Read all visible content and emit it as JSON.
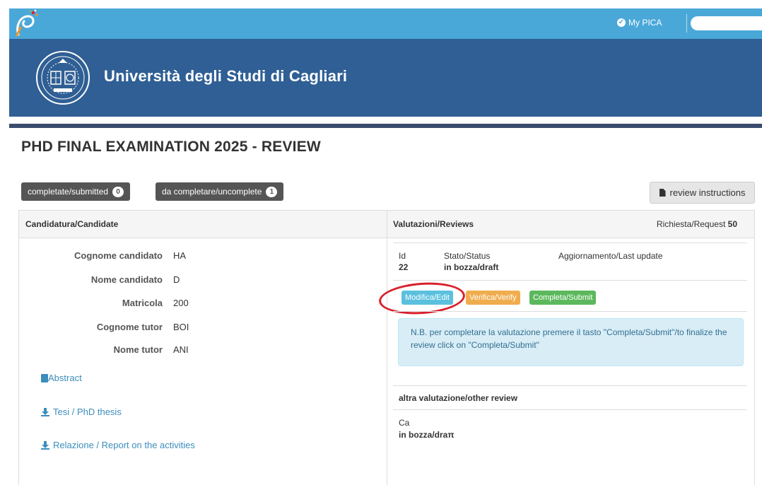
{
  "topbar": {
    "my_pica": "My PICA",
    "colors": {
      "bar": "#4aa8d8",
      "banner": "#2f5f94"
    }
  },
  "banner": {
    "university": "Università degli Studi di Cagliari"
  },
  "page": {
    "title": "PHD FINAL EXAMINATION 2025 - REVIEW"
  },
  "filters": {
    "submitted": {
      "label": "completate/submitted",
      "count": "0"
    },
    "uncomplete": {
      "label": "da completare/uncomplete",
      "count": "1"
    },
    "instructions": "review instructions"
  },
  "candidate": {
    "heading": "Candidatura/Candidate",
    "fields": [
      {
        "label": "Cognome candidato",
        "value": "HA"
      },
      {
        "label": "Nome candidato",
        "value": "D"
      },
      {
        "label": "Matricola",
        "value": "200"
      },
      {
        "label": "Cognome tutor",
        "value": "BOI"
      },
      {
        "label": "Nome tutor",
        "value": "ANI"
      }
    ],
    "links": {
      "abstract": "Abstract",
      "thesis": "Tesi / PhD thesis",
      "report": "Relazione / Report on the activities"
    }
  },
  "reviews": {
    "heading": "Valutazioni/Reviews",
    "request_label": "Richiesta/Request",
    "request_number": "50",
    "columns": {
      "id": "Id",
      "status": "Stato/Status",
      "update": "Aggiornamento/Last update"
    },
    "row": {
      "id": "22",
      "status": "in bozza/draft"
    },
    "actions": {
      "edit": "Modifica/Edit",
      "verify": "Verifica/Verify",
      "submit": "Completa/Submit",
      "colors": {
        "edit": "#5bc0de",
        "verify": "#f0ad4e",
        "submit": "#5cb85c"
      }
    },
    "note": "N.B. per completare la valutazione premere il tasto \"Completa/Submit\"/to finalize the review click on \"Completa/Submit\"",
    "other": {
      "heading": "altra valutazione/other review",
      "id": "Ca",
      "status": "in bozza/draπ"
    }
  }
}
